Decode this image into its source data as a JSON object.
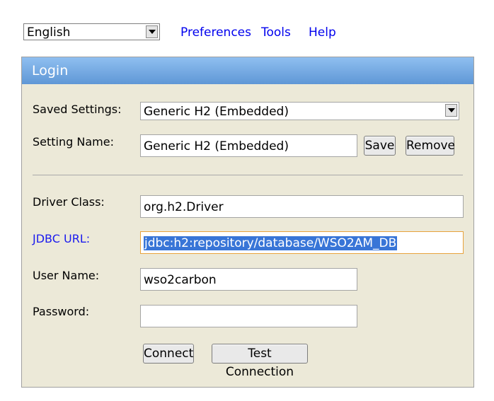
{
  "topbar": {
    "language": "English",
    "links": [
      "Preferences",
      "Tools",
      "Help"
    ]
  },
  "login": {
    "title": "Login",
    "saved_settings_label": "Saved Settings:",
    "saved_settings_value": "Generic H2 (Embedded)",
    "setting_name_label": "Setting Name:",
    "setting_name_value": "Generic H2 (Embedded)",
    "save_label": "Save",
    "remove_label": "Remove",
    "driver_class_label": "Driver Class:",
    "driver_class_value": "org.h2.Driver",
    "jdbc_url_label": "JDBC URL:",
    "jdbc_url_value": "jdbc:h2:repository/database/WSO2AM_DB",
    "user_name_label": "User Name:",
    "user_name_value": "wso2carbon",
    "password_label": "Password:",
    "password_value": "",
    "connect_label": "Connect",
    "test_connection_label": "Test Connection"
  }
}
